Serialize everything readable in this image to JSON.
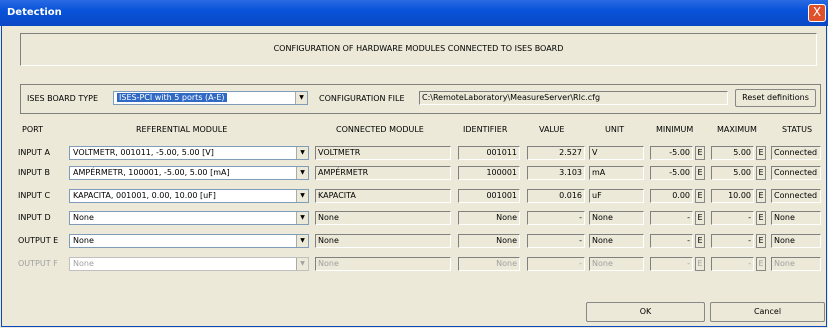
{
  "window": {
    "title": "Detection",
    "close_label": "X"
  },
  "banner": {
    "text": "CONFIGURATION OF HARDWARE MODULES CONNECTED TO ISES BOARD"
  },
  "board": {
    "type_label": "ISES BOARD TYPE",
    "type_value": "ISES-PCI with 5 ports (A-E)",
    "config_label": "CONFIGURATION FILE",
    "config_value": "C:\\RemoteLaboratory\\MeasureServer\\Rlc.cfg",
    "reset_label": "Reset definitions"
  },
  "headers": {
    "port": "PORT",
    "referential": "REFERENTIAL MODULE",
    "connected": "CONNECTED MODULE",
    "identifier": "IDENTIFIER",
    "value": "VALUE",
    "unit": "UNIT",
    "minimum": "MINIMUM",
    "maximum": "MAXIMUM",
    "status": "STATUS"
  },
  "rows": [
    {
      "port": "INPUT A",
      "ref": "VOLTMETR, 001011, -5.00, 5.00 [V]",
      "connected": "VOLTMETR",
      "identifier": "001011",
      "value": "2.527",
      "unit": "V",
      "min": "-5.00",
      "max": "5.00",
      "e": "E",
      "status": "Connected"
    },
    {
      "port": "INPUT B",
      "ref": "AMPÉRMETR, 100001, -5.00, 5.00 [mA]",
      "connected": "AMPÉRMETR",
      "identifier": "100001",
      "value": "3.103",
      "unit": "mA",
      "min": "-5.00",
      "max": "5.00",
      "e": "E",
      "status": "Connected"
    },
    {
      "port": "INPUT C",
      "ref": "KAPACITA, 001001, 0.00, 10.00 [uF]",
      "connected": "KAPACITA",
      "identifier": "001001",
      "value": "0.016",
      "unit": "uF",
      "min": "0.00",
      "max": "10.00",
      "e": "E",
      "status": "Connected"
    },
    {
      "port": "INPUT D",
      "ref": "None",
      "connected": "None",
      "identifier": "None",
      "value": "-",
      "unit": "None",
      "min": "-",
      "max": "-",
      "e": "E",
      "status": "None"
    },
    {
      "port": "OUTPUT E",
      "ref": "None",
      "connected": "None",
      "identifier": "None",
      "value": "-",
      "unit": "None",
      "min": "-",
      "max": "-",
      "e": "E",
      "status": "None"
    },
    {
      "port": "OUTPUT F",
      "ref": "None",
      "connected": "None",
      "identifier": "None",
      "value": "-",
      "unit": "None",
      "min": "-",
      "max": "-",
      "e": "E",
      "status": "None"
    }
  ],
  "buttons": {
    "ok": "OK",
    "cancel": "Cancel"
  }
}
